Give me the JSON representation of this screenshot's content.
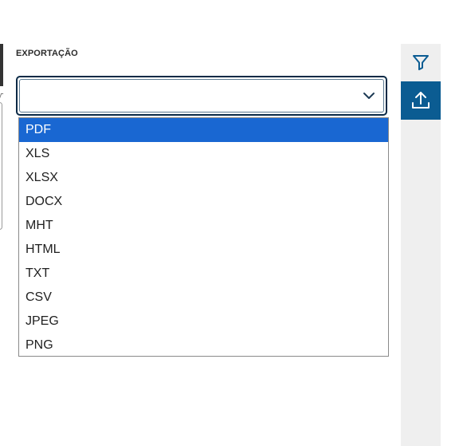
{
  "export_panel": {
    "label": "EXPORTAÇÃO",
    "select": {
      "value": "",
      "icon": "chevron-down-icon"
    },
    "options": [
      {
        "label": "PDF",
        "highlighted": true
      },
      {
        "label": "XLS",
        "highlighted": false
      },
      {
        "label": "XLSX",
        "highlighted": false
      },
      {
        "label": "DOCX",
        "highlighted": false
      },
      {
        "label": "MHT",
        "highlighted": false
      },
      {
        "label": "HTML",
        "highlighted": false
      },
      {
        "label": "TXT",
        "highlighted": false
      },
      {
        "label": "CSV",
        "highlighted": false
      },
      {
        "label": "JPEG",
        "highlighted": false
      },
      {
        "label": "PNG",
        "highlighted": false
      }
    ]
  },
  "sidebar": {
    "buttons": [
      {
        "icon": "filter-icon",
        "active": false
      },
      {
        "icon": "export-upload-icon",
        "active": true
      }
    ]
  },
  "colors": {
    "highlight": "#1967d2",
    "select_border": "#0b2a46",
    "sidebar_active": "#0b5c92",
    "sidebar_bg": "#efefef",
    "filter_icon": "#0b5c92"
  }
}
